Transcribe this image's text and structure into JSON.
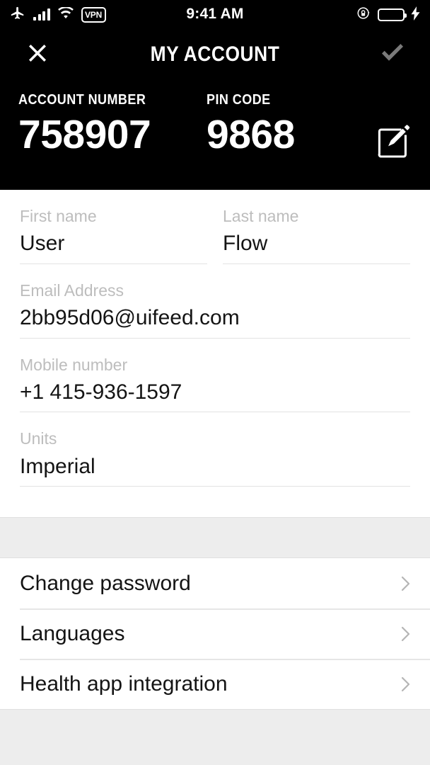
{
  "status_bar": {
    "time": "9:41 AM",
    "airplane_icon": "airplane-icon",
    "signal_icon": "signal-bars-icon",
    "wifi_icon": "wifi-icon",
    "vpn_label": "VPN",
    "rotation_lock_icon": "rotation-lock-icon",
    "battery_icon": "battery-full-icon",
    "charging_icon": "charging-bolt-icon",
    "battery_color": "#44d658"
  },
  "navbar": {
    "title": "MY ACCOUNT",
    "close_icon": "close-x-icon",
    "confirm_icon": "checkmark-icon",
    "confirm_color": "#7a7a7a",
    "background": "#000000"
  },
  "account": {
    "number_label": "ACCOUNT NUMBER",
    "number_value": "758907",
    "pin_label": "PIN CODE",
    "pin_value": "9868",
    "edit_icon": "edit-pencil-square-icon"
  },
  "form": {
    "fields": [
      {
        "label": "First name",
        "value": "User"
      },
      {
        "label": "Last name",
        "value": "Flow"
      },
      {
        "label": "Email Address",
        "value": "2bb95d06@uifeed.com"
      },
      {
        "label": "Mobile number",
        "value": "+1 415-936-1597"
      },
      {
        "label": "Units",
        "value": "Imperial"
      }
    ]
  },
  "settings_list": {
    "items": [
      {
        "label": "Change password",
        "chevron": "chevron-right-icon"
      },
      {
        "label": "Languages",
        "chevron": "chevron-right-icon"
      },
      {
        "label": "Health app integration",
        "chevron": "chevron-right-icon"
      }
    ]
  },
  "colors": {
    "header_bg": "#000000",
    "page_bg": "#ffffff",
    "band_bg": "#ededed",
    "label_gray": "#bdbdbd",
    "text_dark": "#141414",
    "divider": "#e2e2e2"
  }
}
